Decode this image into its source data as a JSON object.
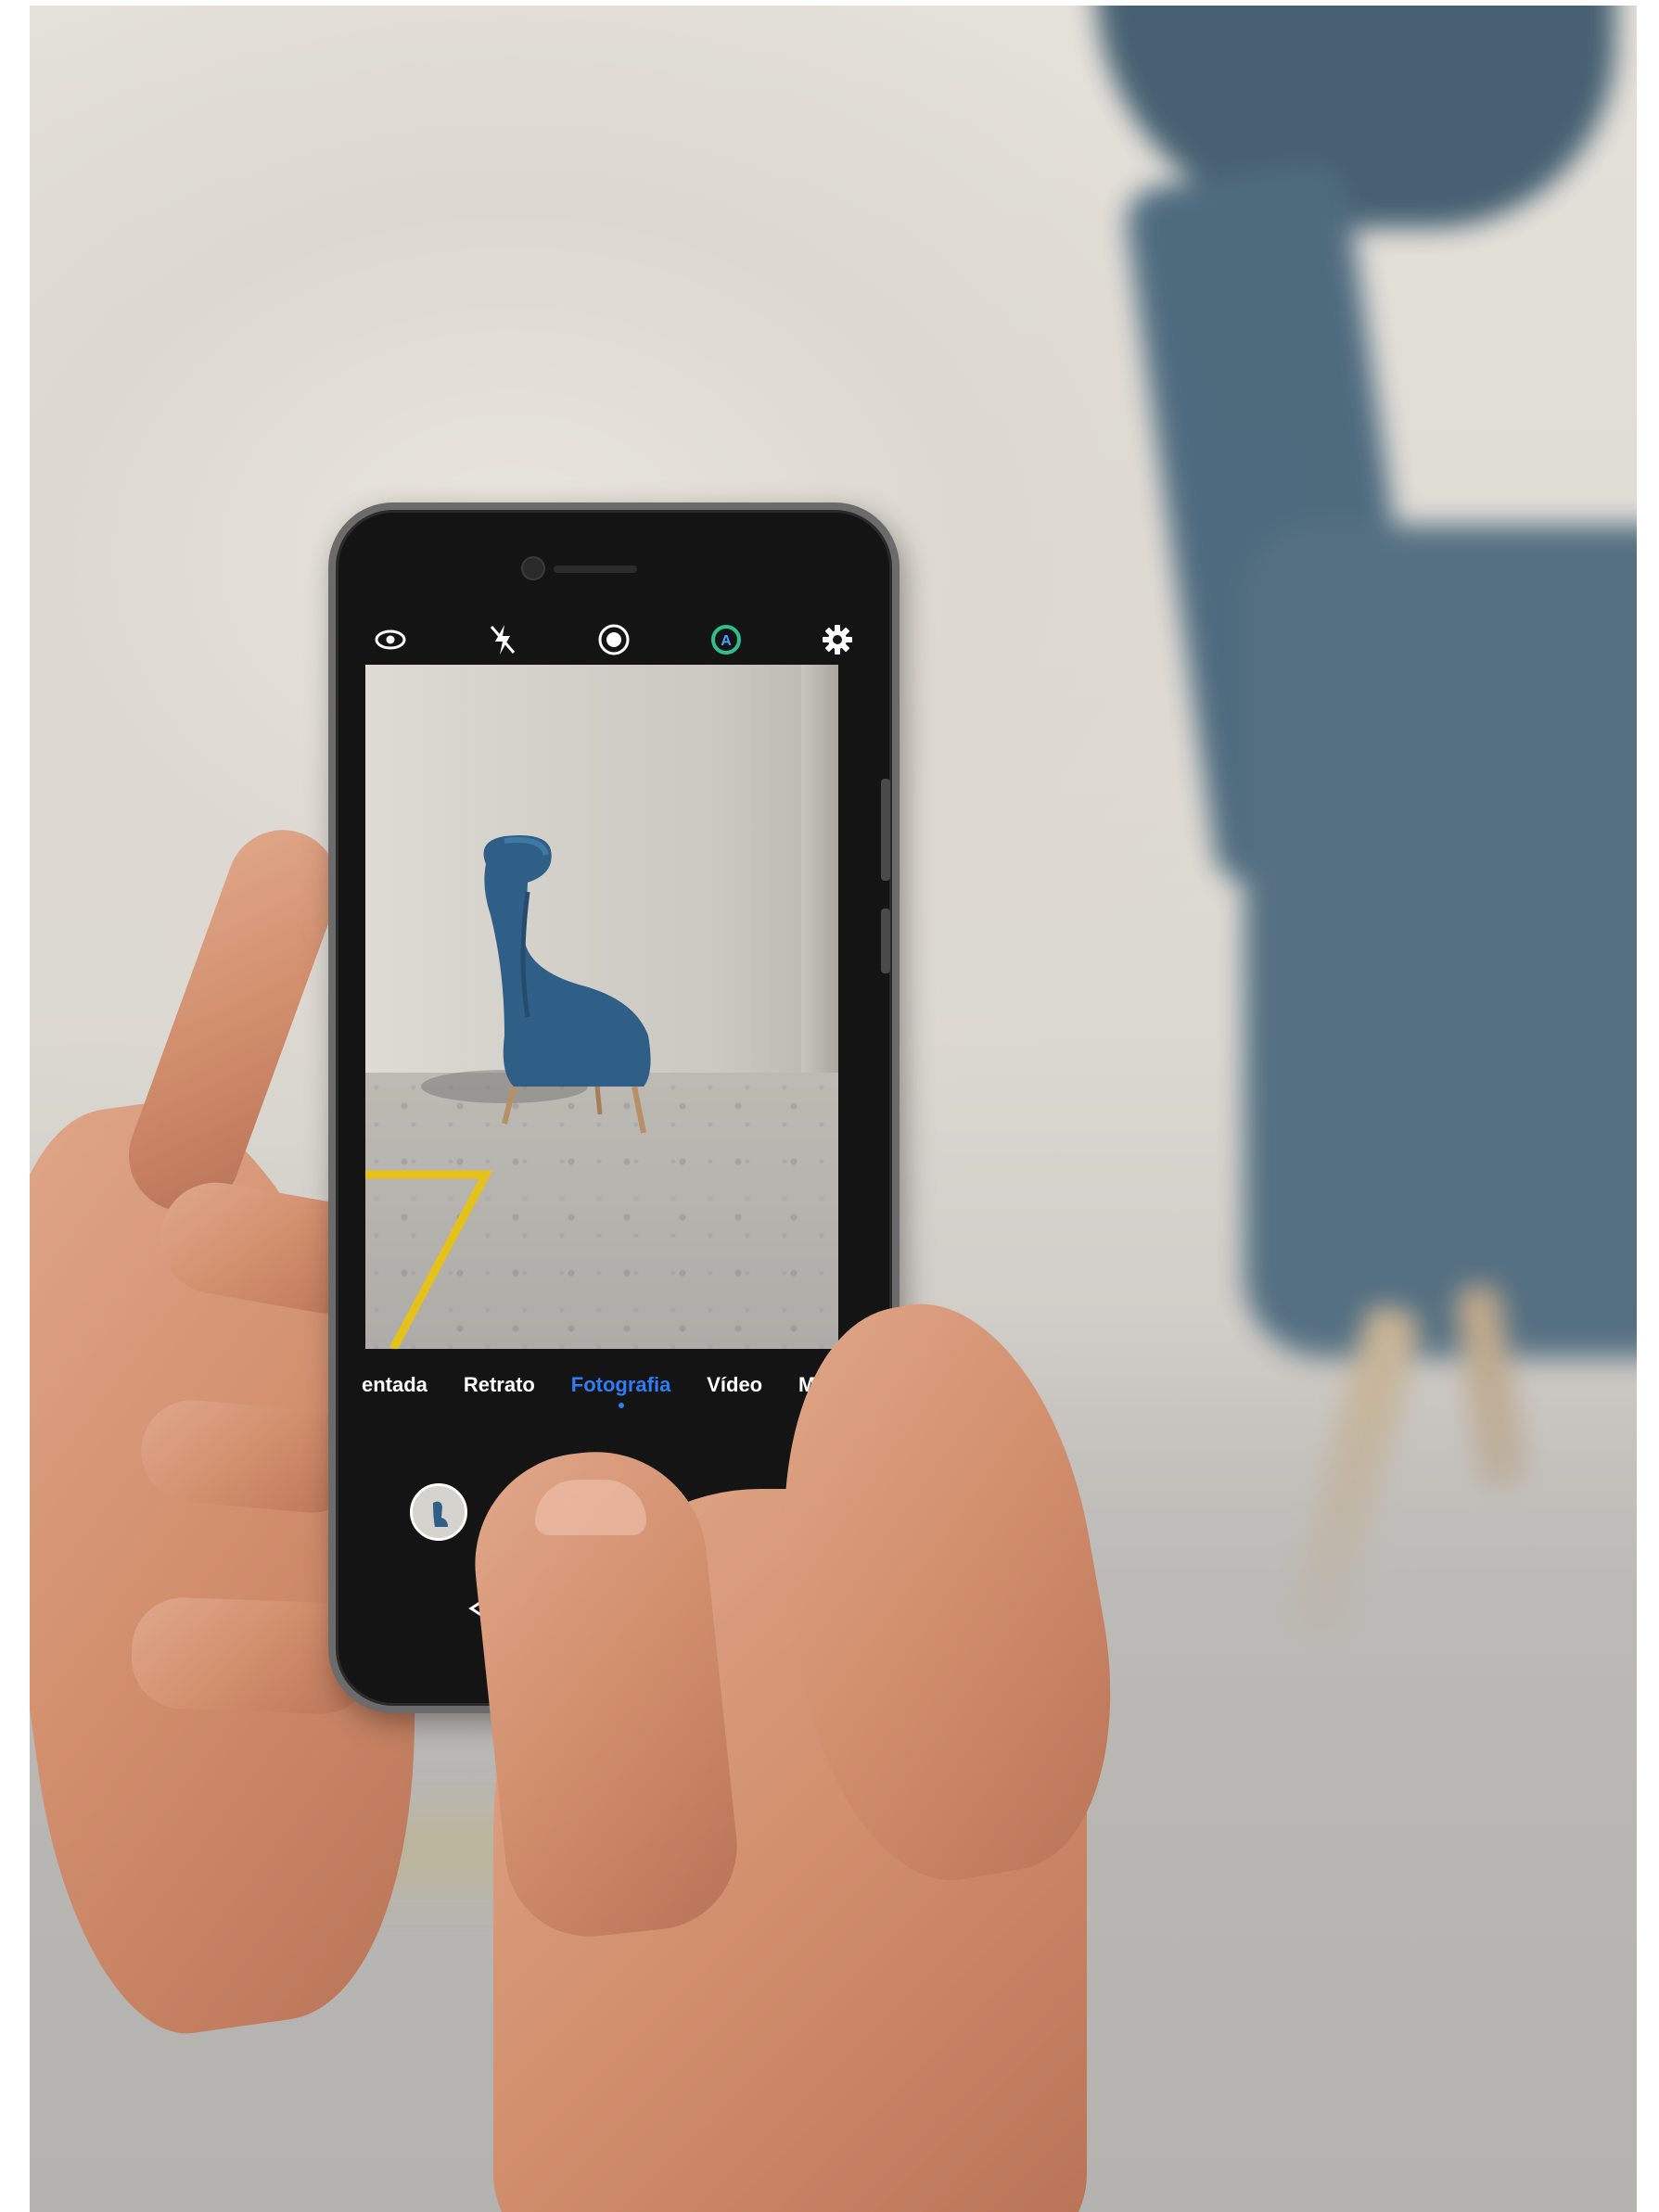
{
  "camera_app": {
    "top_icons": [
      "eye-icon",
      "flash-off-icon",
      "aperture-icon",
      "ai-mode-icon",
      "settings-gear-icon"
    ],
    "modes": [
      {
        "label": "entada",
        "active": false
      },
      {
        "label": "Retrato",
        "active": false
      },
      {
        "label": "Fotografia",
        "active": true
      },
      {
        "label": "Vídeo",
        "active": false
      },
      {
        "label": "Mais",
        "active": false
      }
    ],
    "colors": {
      "active_mode": "#2e7cf6",
      "ai_icon": "#2fbf8f",
      "chair": "#2f5f86",
      "floor_marking": "#e5c11c"
    }
  }
}
